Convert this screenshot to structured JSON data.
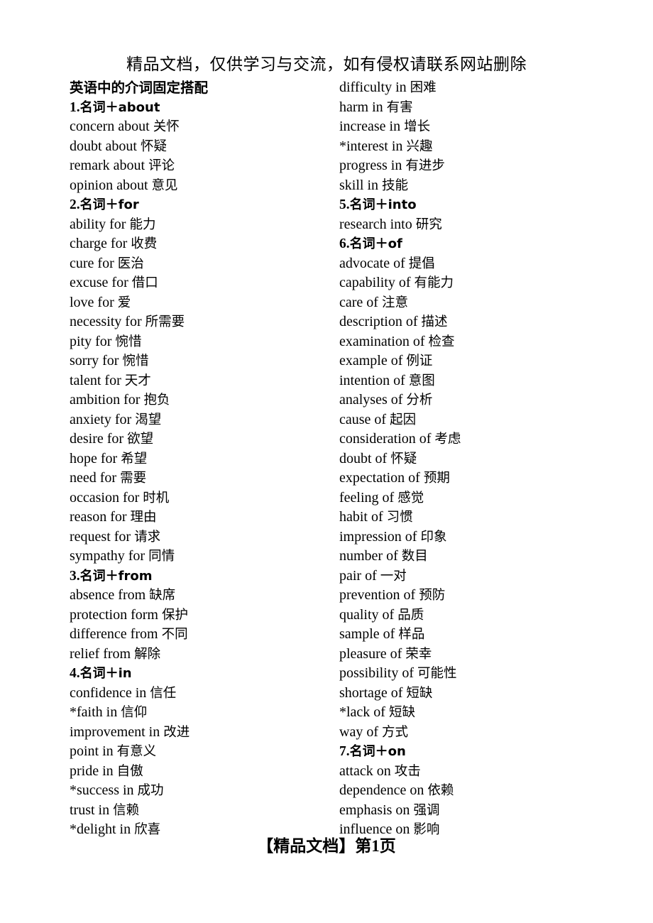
{
  "document": {
    "header_notice": "精品文档，仅供学习与交流，如有侵权请联系网站删除",
    "footer_label": "【精品文档】第",
    "footer_page": "1",
    "footer_unit": "页",
    "title": "英语中的介词固定搭配",
    "text_color": "#000000",
    "background_color": "#ffffff"
  },
  "left_column": [
    {
      "type": "title",
      "en": "",
      "cn": "英语中的介词固定搭配"
    },
    {
      "type": "heading",
      "en": "1.",
      "cn": "名词＋about",
      "bold_en_tail": "about"
    },
    {
      "type": "entry",
      "en": "concern about ",
      "cn": "关怀"
    },
    {
      "type": "entry",
      "en": "doubt about ",
      "cn": "怀疑"
    },
    {
      "type": "entry",
      "en": "remark about  ",
      "cn": "评论"
    },
    {
      "type": "entry",
      "en": "opinion about ",
      "cn": "意见"
    },
    {
      "type": "heading",
      "en": "2.",
      "cn": "名词＋for"
    },
    {
      "type": "entry",
      "en": "ability for ",
      "cn": "能力"
    },
    {
      "type": "entry",
      "en": "charge for ",
      "cn": "收费"
    },
    {
      "type": "entry",
      "en": "cure for ",
      "cn": "医治"
    },
    {
      "type": "entry",
      "en": "excuse for ",
      "cn": "借口"
    },
    {
      "type": "entry",
      "en": "love for ",
      "cn": "爱"
    },
    {
      "type": "entry",
      "en": "necessity for ",
      "cn": "所需要"
    },
    {
      "type": "entry",
      "en": "pity for ",
      "cn": "惋惜"
    },
    {
      "type": "entry",
      "en": "sorry for  ",
      "cn": "惋惜"
    },
    {
      "type": "entry",
      "en": "talent for ",
      "cn": "天才"
    },
    {
      "type": "entry",
      "en": "ambition for ",
      "cn": "抱负"
    },
    {
      "type": "entry",
      "en": "anxiety for ",
      "cn": "渴望"
    },
    {
      "type": "entry",
      "en": "desire for ",
      "cn": "欲望"
    },
    {
      "type": "entry",
      "en": "hope for ",
      "cn": "希望"
    },
    {
      "type": "entry",
      "en": "need for ",
      "cn": "需要"
    },
    {
      "type": "entry",
      "en": "occasion for ",
      "cn": "时机"
    },
    {
      "type": "entry",
      "en": "reason for ",
      "cn": "理由"
    },
    {
      "type": "entry",
      "en": "request for ",
      "cn": "请求"
    },
    {
      "type": "entry",
      "en": "sympathy for ",
      "cn": "同情"
    },
    {
      "type": "heading",
      "en": "3.",
      "cn": "名词＋from"
    },
    {
      "type": "entry",
      "en": "absence from  ",
      "cn": "缺席"
    },
    {
      "type": "entry",
      "en": "protection form ",
      "cn": "保护"
    },
    {
      "type": "entry",
      "en": "difference from ",
      "cn": "不同"
    },
    {
      "type": "entry",
      "en": "relief from ",
      "cn": "解除"
    },
    {
      "type": "heading",
      "en": "4.",
      "cn": "名词＋in"
    },
    {
      "type": "entry",
      "en": "confidence in   ",
      "cn": "信任"
    },
    {
      "type": "entry",
      "en": "*faith in ",
      "cn": "信仰"
    },
    {
      "type": "entry",
      "en": "improvement in ",
      "cn": "改进"
    },
    {
      "type": "entry",
      "en": "point in ",
      "cn": "有意义"
    },
    {
      "type": "entry",
      "en": "pride in ",
      "cn": "自傲"
    },
    {
      "type": "entry",
      "en": "*success in ",
      "cn": "成功"
    },
    {
      "type": "entry",
      "en": "trust in ",
      "cn": "信赖"
    },
    {
      "type": "entry",
      "en": "*delight in ",
      "cn": "欣喜"
    }
  ],
  "right_column": [
    {
      "type": "entry",
      "en": "difficulty in ",
      "cn": "困难"
    },
    {
      "type": "entry",
      "en": "harm in  ",
      "cn": "有害"
    },
    {
      "type": "entry",
      "en": "increase in ",
      "cn": "增长"
    },
    {
      "type": "entry",
      "en": "*interest in  ",
      "cn": "兴趣"
    },
    {
      "type": "entry",
      "en": "progress in ",
      "cn": "有进步"
    },
    {
      "type": "entry",
      "en": "skill in ",
      "cn": "技能"
    },
    {
      "type": "heading",
      "en": "5.",
      "cn": "名词＋into"
    },
    {
      "type": "entry",
      "en": "research into ",
      "cn": "研究"
    },
    {
      "type": "heading",
      "en": "6.",
      "cn": "名词＋of"
    },
    {
      "type": "entry",
      "en": "advocate of ",
      "cn": "提倡"
    },
    {
      "type": "entry",
      "en": "capability of ",
      "cn": "有能力"
    },
    {
      "type": "entry",
      "en": "care of ",
      "cn": "注意"
    },
    {
      "type": "entry",
      "en": "description of ",
      "cn": "描述"
    },
    {
      "type": "entry",
      "en": "examination of ",
      "cn": "检查"
    },
    {
      "type": "entry",
      "en": "example of ",
      "cn": "例证"
    },
    {
      "type": "entry",
      "en": "intention of ",
      "cn": "意图"
    },
    {
      "type": "entry",
      "en": "analyses of ",
      "cn": "分析"
    },
    {
      "type": "entry",
      "en": "cause of ",
      "cn": "起因"
    },
    {
      "type": "entry",
      "en": "consideration of ",
      "cn": "考虑"
    },
    {
      "type": "entry",
      "en": "doubt of ",
      "cn": "怀疑"
    },
    {
      "type": "entry",
      "en": "expectation of ",
      "cn": "预期"
    },
    {
      "type": "entry",
      "en": "feeling of ",
      "cn": "感觉"
    },
    {
      "type": "entry",
      "en": "habit of ",
      "cn": "习惯"
    },
    {
      "type": "entry",
      "en": "impression of ",
      "cn": "印象"
    },
    {
      "type": "entry",
      "en": "number of ",
      "cn": "数目"
    },
    {
      "type": "entry",
      "en": "pair of  ",
      "cn": "一对"
    },
    {
      "type": "entry",
      "en": "prevention of ",
      "cn": "预防"
    },
    {
      "type": "entry",
      "en": "quality of  ",
      "cn": "品质"
    },
    {
      "type": "entry",
      "en": "sample of ",
      "cn": "样品"
    },
    {
      "type": "entry",
      "en": "pleasure of ",
      "cn": "荣幸"
    },
    {
      "type": "entry",
      "en": "possibility of ",
      "cn": "可能性"
    },
    {
      "type": "entry",
      "en": "shortage of ",
      "cn": "短缺"
    },
    {
      "type": "entry",
      "en": "*lack of ",
      "cn": "短缺"
    },
    {
      "type": "entry",
      "en": "way of ",
      "cn": "方式"
    },
    {
      "type": "heading",
      "en": "7.",
      "cn": "名词＋on"
    },
    {
      "type": "entry",
      "en": "attack on ",
      "cn": "攻击"
    },
    {
      "type": "entry",
      "en": "dependence on ",
      "cn": "依赖"
    },
    {
      "type": "entry",
      "en": "emphasis on ",
      "cn": "强调"
    },
    {
      "type": "entry",
      "en": "influence on ",
      "cn": "影响"
    }
  ]
}
